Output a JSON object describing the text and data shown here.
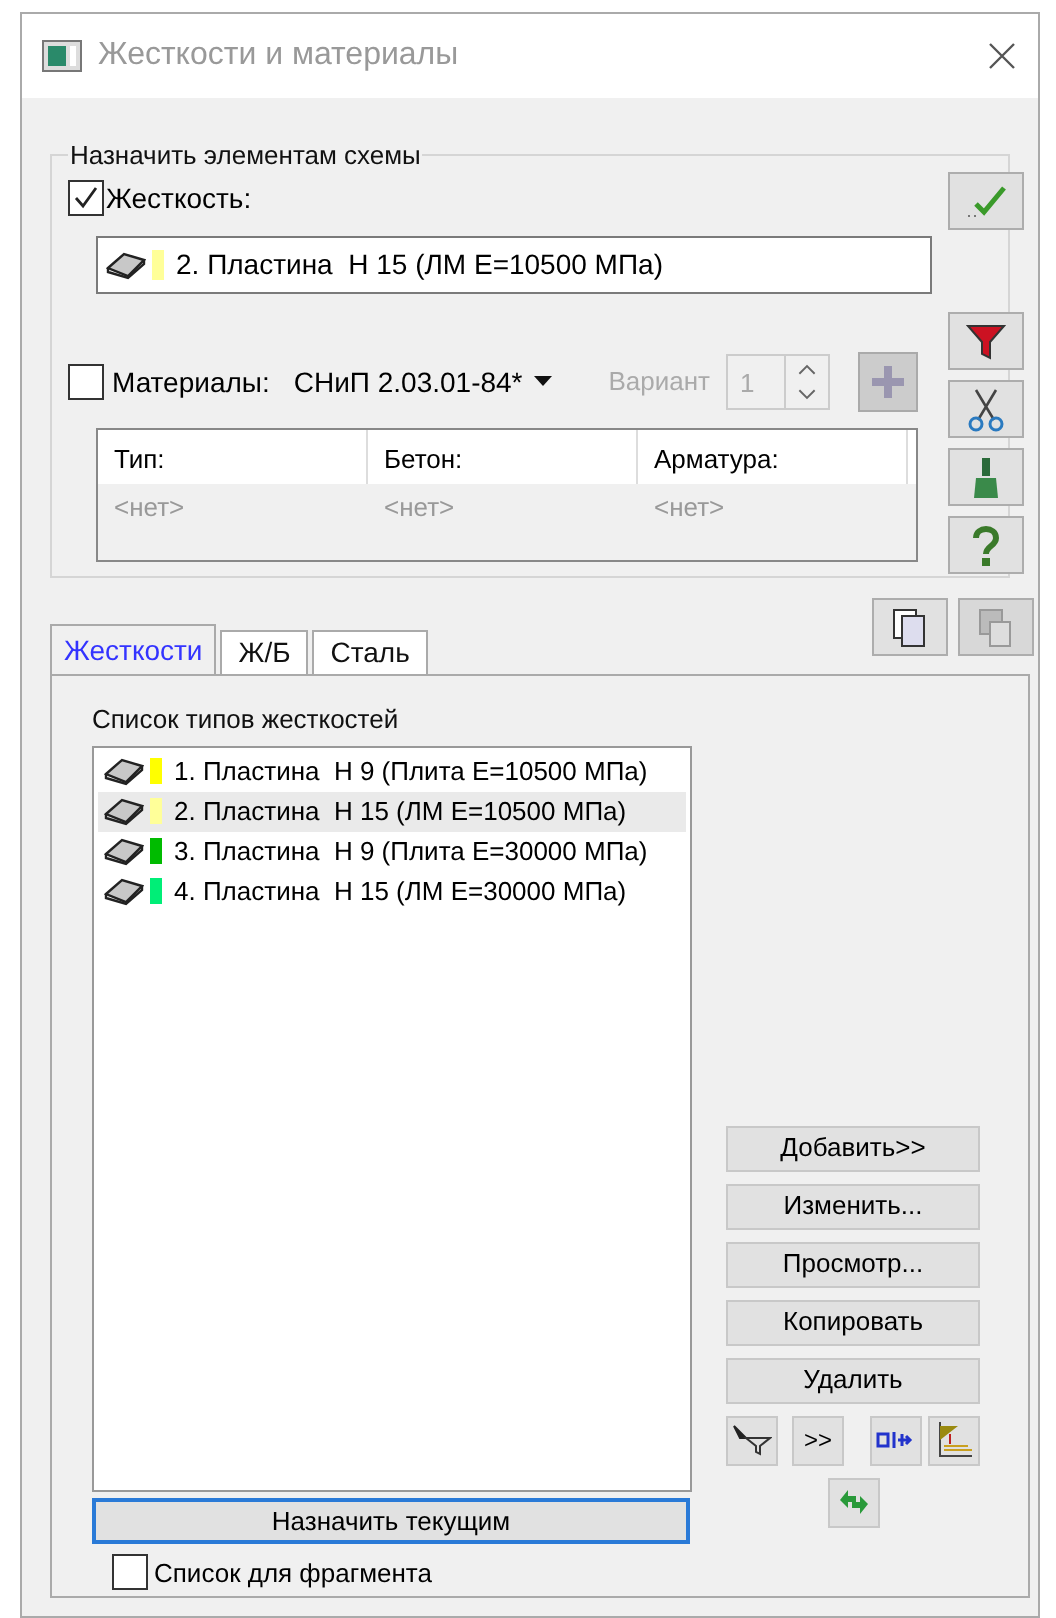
{
  "window": {
    "title": "Жесткости и материалы"
  },
  "assign_group": {
    "title": "Назначить элементам схемы",
    "stiffness": {
      "label": "Жесткость:",
      "checked": true,
      "value": "2. Пластина  Н 15 (ЛМ Е=10500 МПа)",
      "color": "#ffff99"
    },
    "materials": {
      "label": "Материалы:",
      "checked": false,
      "norm": "СНиП 2.03.01-84*",
      "variant_label": "Вариант",
      "variant_value": "1"
    },
    "table": {
      "columns": [
        "Тип:",
        "Бетон:",
        "Арматура:"
      ],
      "rows": [
        [
          "<нет>",
          "<нет>",
          "<нет>"
        ]
      ]
    }
  },
  "tabs": [
    {
      "label": "Жесткости",
      "selected": true
    },
    {
      "label": "Ж/Б",
      "selected": false
    },
    {
      "label": "Сталь",
      "selected": false
    }
  ],
  "list_label": "Список типов жесткостей",
  "items": [
    {
      "label": "1. Пластина  Н 9 (Плита Е=10500 МПа)",
      "color": "#ffff00",
      "selected": false
    },
    {
      "label": "2. Пластина  Н 15 (ЛМ Е=10500 МПа)",
      "color": "#ffff99",
      "selected": true
    },
    {
      "label": "3. Пластина  Н 9 (Плита Е=30000 МПа)",
      "color": "#00bb00",
      "selected": false
    },
    {
      "label": "4. Пластина  Н 15 (ЛМ Е=30000 МПа)",
      "color": "#00ee77",
      "selected": false
    }
  ],
  "buttons": [
    "Добавить>>",
    "Изменить...",
    "Просмотр...",
    "Копировать",
    "Удалить"
  ],
  "small_buttons": [
    ">>"
  ],
  "assign_button": "Назначить текущим",
  "fragment": {
    "label": "Список для фрагмента",
    "checked": false
  }
}
